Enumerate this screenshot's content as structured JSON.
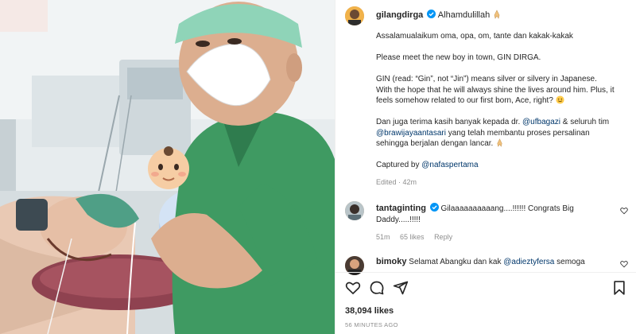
{
  "post": {
    "author": "gilangdirga",
    "headline": "Alhamdulillah",
    "paragraphs": {
      "p1": "Assalamualaikum oma, opa, om, tante dan kakak-kakak",
      "p2": "Please meet the new boy in town, GIN DIRGA.",
      "p3": "GIN (read: “Gin”, not “Jin”) means silver or silvery in Japanese. With the hope that he will always shine the lives around him. Plus, it feels somehow related to our first born, Ace, right?",
      "p4_a": "Dan juga terima kasih banyak kepada dr.",
      "p4_mention1": "@ufbagazi",
      "p4_b": "& seluruh tim",
      "p4_mention2": "@brawijayaantasari",
      "p4_c": "yang telah membantu proses persalinan sehingga berjalan dengan lancar.",
      "p5_a": "Captured by",
      "p5_mention": "@nafaspertama"
    },
    "edited": "Edited",
    "time": "42m"
  },
  "comments": [
    {
      "user": "tantaginting",
      "text": "Gilaaaaaaaaaang....!!!!!! Congrats Big Daddy.....!!!!!",
      "time": "51m",
      "likes": "65 likes",
      "reply": "Reply"
    },
    {
      "user": "bimoky",
      "text_a": "Selamat Abangku dan kak",
      "mention": "@adieztyfersa",
      "text_b": "semoga"
    }
  ],
  "footer": {
    "likes": "38,094 likes",
    "posted": "56 MINUTES AGO"
  },
  "icons": [
    "folded-hands-emoji",
    "smile-emoji",
    "verified-badge",
    "heart-icon",
    "comment-icon",
    "share-icon",
    "bookmark-icon",
    "baby-emoji"
  ],
  "colors": {
    "verified": "#0095f6",
    "mention": "#00376b",
    "meta": "#8e8e8e",
    "scrubs": "#3f9a62"
  }
}
